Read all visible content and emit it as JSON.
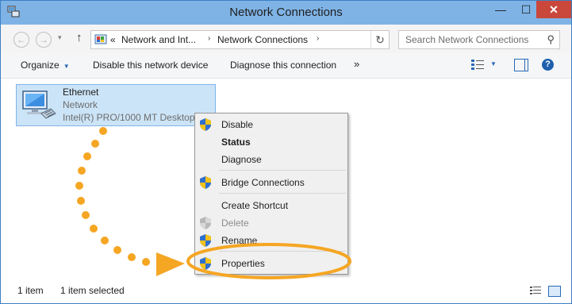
{
  "window": {
    "title": "Network Connections"
  },
  "titlebar_buttons": {
    "minimize": "—",
    "maximize": "☐",
    "close": "✕"
  },
  "nav": {
    "back_glyph": "←",
    "forward_glyph": "→",
    "recent_glyph": "▾",
    "up_glyph": "↑",
    "address": {
      "prefix": "«",
      "crumbs": [
        "Network and Int...",
        "Network Connections"
      ],
      "sep_glyph": "›"
    },
    "refresh_glyph": "↻",
    "search": {
      "placeholder": "Search Network Connections",
      "icon_glyph": "⚲"
    }
  },
  "toolbar": {
    "organize": "Organize",
    "organize_caret": "▼",
    "disable_device": "Disable this network device",
    "diagnose": "Diagnose this connection",
    "overflow": "»",
    "views_caret": "▼",
    "help_glyph": "?"
  },
  "content": {
    "items": [
      {
        "name": "Ethernet",
        "type": "Network",
        "device": "Intel(R) PRO/1000 MT Desktop Ad"
      }
    ]
  },
  "context_menu": {
    "items": [
      {
        "label": "Disable",
        "shield": true,
        "bold": false,
        "disabled": false
      },
      {
        "label": "Status",
        "shield": false,
        "bold": true,
        "disabled": false
      },
      {
        "label": "Diagnose",
        "shield": false,
        "bold": false,
        "disabled": false
      },
      {
        "label": "Bridge Connections",
        "shield": true,
        "bold": false,
        "disabled": false
      },
      {
        "label": "Create Shortcut",
        "shield": false,
        "bold": false,
        "disabled": false
      },
      {
        "label": "Delete",
        "shield": true,
        "bold": false,
        "disabled": true
      },
      {
        "label": "Rename",
        "shield": true,
        "bold": false,
        "disabled": false
      },
      {
        "label": "Properties",
        "shield": true,
        "bold": false,
        "disabled": false
      }
    ]
  },
  "statusbar": {
    "item_count": "1 item",
    "selected_count": "1 item selected"
  },
  "colors": {
    "titlebar": "#7fb3e6",
    "selection": "#cce4f7",
    "annotation": "#f5a623",
    "close_button": "#c9483b"
  }
}
